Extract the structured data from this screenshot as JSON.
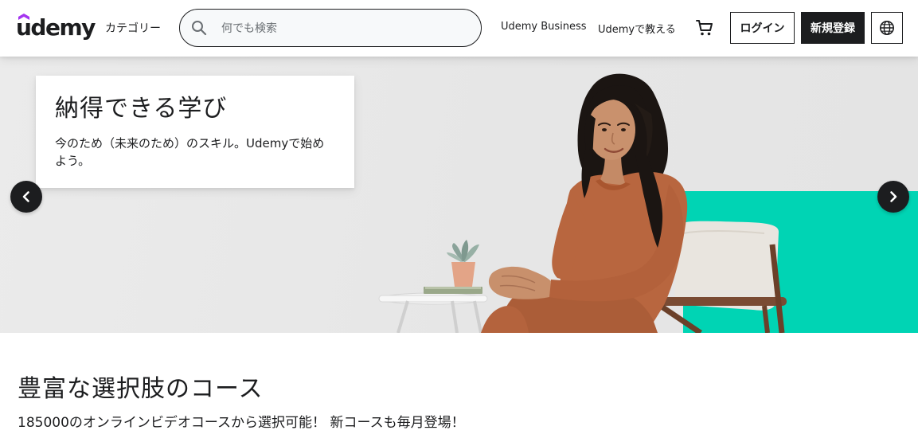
{
  "header": {
    "logo_text": "udemy",
    "categories_label": "カテゴリー",
    "search": {
      "placeholder": "何でも検索",
      "value": ""
    },
    "business_link": "Udemy Business",
    "teach_link": "Udemyで教える",
    "login_label": "ログイン",
    "signup_label": "新規登録",
    "icons": {
      "search": "search-icon",
      "cart": "cart-icon",
      "language": "globe-icon"
    }
  },
  "hero": {
    "title": "納得できる学び",
    "subtitle": "今のため（未来のため）のスキル。Udemyで始めよう。",
    "colors": {
      "accent": "#00d4b4",
      "background": "#e9e9e9",
      "sweater": "#b8663f"
    },
    "nav_icons": {
      "prev": "chevron-left-icon",
      "next": "chevron-right-icon"
    }
  },
  "section": {
    "title": "豊富な選択肢のコース",
    "subtitle": "185000のオンラインビデオコースから選択可能！ 新コースも毎月登場！"
  },
  "colors": {
    "text": "#1c1d1f",
    "brand_purple": "#a435f0",
    "button_dark": "#1c1d1f"
  }
}
